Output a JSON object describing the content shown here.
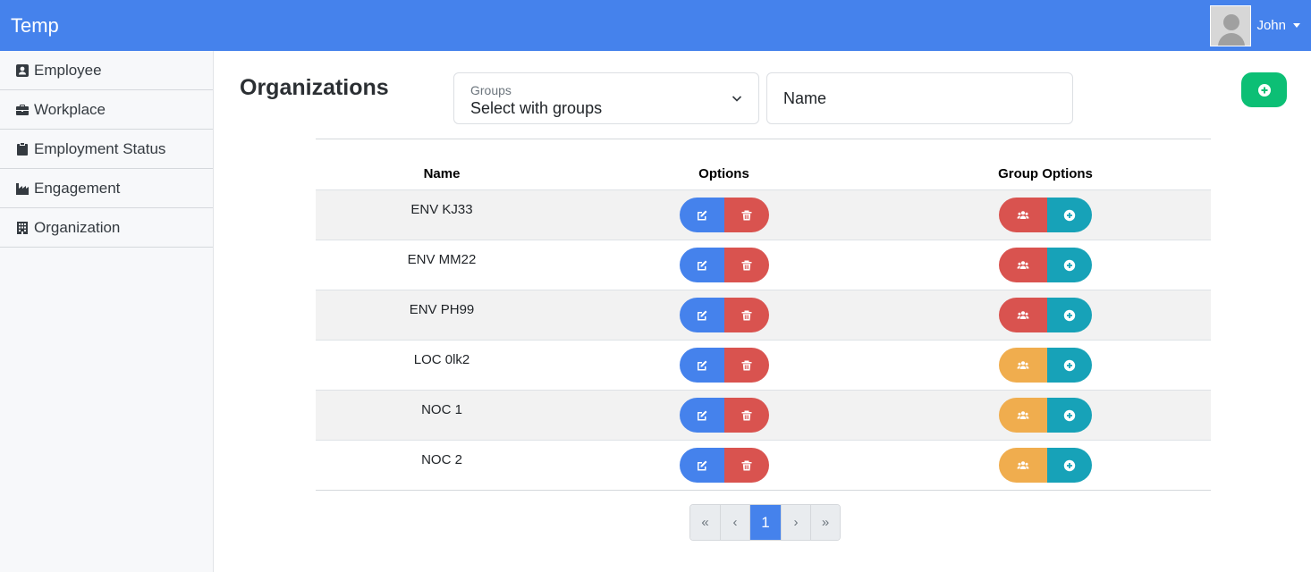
{
  "app": {
    "brand": "Temp"
  },
  "user": {
    "name": "John"
  },
  "sidebar": {
    "items": [
      {
        "label": "Employee",
        "icon": "contact-card-icon"
      },
      {
        "label": "Workplace",
        "icon": "briefcase-icon"
      },
      {
        "label": "Employment Status",
        "icon": "clipboard-icon"
      },
      {
        "label": "Engagement",
        "icon": "factory-icon"
      },
      {
        "label": "Organization",
        "icon": "building-icon"
      }
    ]
  },
  "page": {
    "title": "Organizations"
  },
  "filters": {
    "groups_label": "Groups",
    "groups_value": "Select with groups",
    "name_placeholder": "Name"
  },
  "table": {
    "headers": {
      "name": "Name",
      "options": "Options",
      "group_options": "Group Options"
    },
    "rows": [
      {
        "name": "ENV KJ33",
        "group_color": "red"
      },
      {
        "name": "ENV MM22",
        "group_color": "red"
      },
      {
        "name": "ENV PH99",
        "group_color": "red"
      },
      {
        "name": "LOC 0lk2",
        "group_color": "orange"
      },
      {
        "name": "NOC 1",
        "group_color": "orange"
      },
      {
        "name": "NOC 2",
        "group_color": "orange"
      }
    ]
  },
  "pagination": {
    "first": "«",
    "prev": "‹",
    "current": "1",
    "next": "›",
    "last": "»"
  },
  "colors": {
    "primary": "#4582ec",
    "danger": "#d9534f",
    "warning": "#f0ad4e",
    "info": "#17a2b8",
    "success": "#0cbf75"
  }
}
